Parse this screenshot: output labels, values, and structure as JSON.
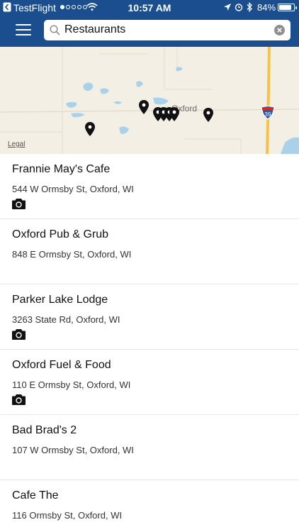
{
  "status_bar": {
    "back_app": "TestFlight",
    "time": "10:57 AM",
    "battery": "84%",
    "battery_level": 0.84,
    "signal_dots_filled": 1,
    "signal_dots_total": 5
  },
  "search": {
    "value": "Restaurants"
  },
  "map": {
    "town_label": "Oxford",
    "legal": "Legal",
    "highway_number": "39"
  },
  "results": [
    {
      "name": "Frannie May's Cafe",
      "address": "544 W Ormsby St, Oxford, WI",
      "has_photo": true
    },
    {
      "name": "Oxford Pub & Grub",
      "address": "848 E Ormsby St, Oxford, WI",
      "has_photo": false
    },
    {
      "name": "Parker Lake Lodge",
      "address": "3263 State Rd, Oxford, WI",
      "has_photo": true
    },
    {
      "name": "Oxford Fuel & Food",
      "address": "110 E Ormsby St, Oxford, WI",
      "has_photo": true
    },
    {
      "name": "Bad Brad's 2",
      "address": "107 W Ormsby St, Oxford, WI",
      "has_photo": false
    },
    {
      "name": "Cafe The",
      "address": "116 Ormsby St, Oxford, WI",
      "has_photo": false
    }
  ],
  "colors": {
    "app_bar": "#1b4e8f",
    "map_land": "#f4efe4",
    "water": "#a9d2ea",
    "highway": "#f5c34a",
    "pin": "#111111"
  },
  "icons": {
    "menu": "hamburger-menu-icon",
    "search": "search-icon",
    "clear": "clear-icon",
    "pin": "map-pin-icon",
    "photo": "camera-icon"
  }
}
